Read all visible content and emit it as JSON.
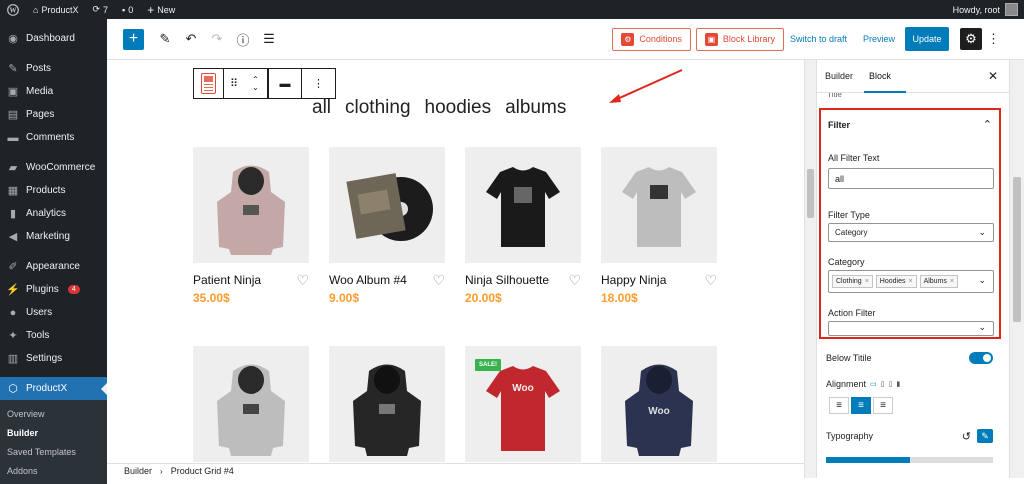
{
  "adminbar": {
    "site_name": "ProductX",
    "updates_count": "7",
    "comments_count": "0",
    "new_label": "New",
    "howdy": "Howdy, root"
  },
  "sidebar": {
    "items": [
      {
        "label": "Dashboard",
        "icon": "dashboard-icon"
      },
      {
        "label": "Posts",
        "icon": "pin-icon"
      },
      {
        "label": "Media",
        "icon": "media-icon"
      },
      {
        "label": "Pages",
        "icon": "pages-icon"
      },
      {
        "label": "Comments",
        "icon": "comments-icon"
      },
      {
        "label": "WooCommerce",
        "icon": "woocommerce-icon"
      },
      {
        "label": "Products",
        "icon": "products-icon"
      },
      {
        "label": "Analytics",
        "icon": "analytics-icon"
      },
      {
        "label": "Marketing",
        "icon": "marketing-icon"
      },
      {
        "label": "Appearance",
        "icon": "appearance-icon"
      },
      {
        "label": "Plugins",
        "icon": "plugins-icon",
        "badge": "4"
      },
      {
        "label": "Users",
        "icon": "users-icon"
      },
      {
        "label": "Tools",
        "icon": "tools-icon"
      },
      {
        "label": "Settings",
        "icon": "settings-icon"
      },
      {
        "label": "ProductX",
        "icon": "productx-icon"
      }
    ],
    "submenu": [
      "Overview",
      "Builder",
      "Saved Templates",
      "Addons"
    ]
  },
  "toolbar": {
    "conditions_label": "Conditions",
    "block_library_label": "Block Library",
    "switch_draft_label": "Switch to draft",
    "preview_label": "Preview",
    "update_label": "Update"
  },
  "canvas": {
    "filters": [
      "all",
      "clothing",
      "hoodies",
      "albums"
    ],
    "products": [
      {
        "name": "Patient Ninja",
        "price": "35.00$"
      },
      {
        "name": "Woo Album #4",
        "price": "9.00$"
      },
      {
        "name": "Ninja Silhouette",
        "price": "20.00$"
      },
      {
        "name": "Happy Ninja",
        "price": "18.00$"
      }
    ],
    "sale_badge": "SALE!"
  },
  "footer": {
    "crumbs": [
      "Builder",
      "Product Grid #4"
    ]
  },
  "panel": {
    "tabs": [
      "Builder",
      "Block"
    ],
    "clipped_label": "Title",
    "filter": {
      "title": "Filter",
      "all_filter_text_label": "All Filter Text",
      "all_filter_text_value": "all",
      "filter_type_label": "Filter Type",
      "filter_type_value": "Category",
      "category_label": "Category",
      "category_chips": [
        "Clothing",
        "Hoodies",
        "Albums"
      ],
      "action_filter_label": "Action Filter",
      "action_filter_value": ""
    },
    "below_title_label": "Below Titile",
    "below_title_on": true,
    "alignment_label": "Alignment",
    "typography_label": "Typography"
  },
  "colors": {
    "wp_dark": "#1d2327",
    "accent": "#007cba",
    "productx_red": "#e34a36",
    "price_orange": "#ff9b2e",
    "sale_green": "#37b24d",
    "highlight_red": "#e0251b"
  }
}
